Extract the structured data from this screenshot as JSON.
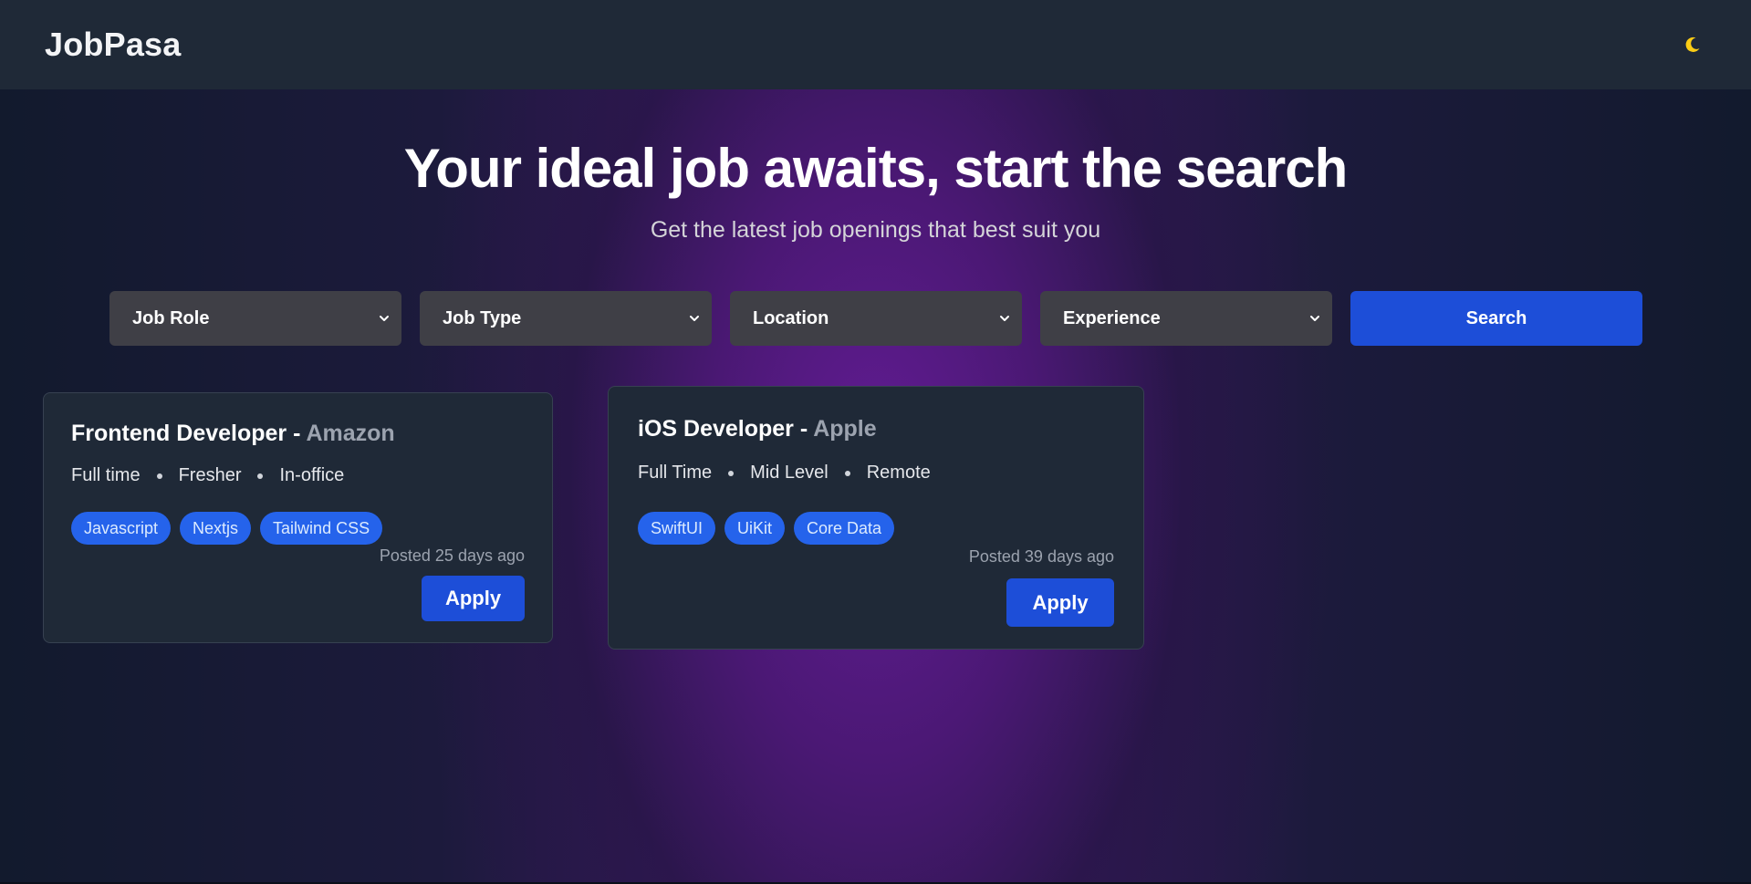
{
  "navbar": {
    "brand": "JobPasa",
    "theme_icon": "crescent-moon-icon"
  },
  "hero": {
    "title": "Your ideal job awaits, start the search",
    "subtitle": "Get the latest job openings that best suit you"
  },
  "filters": {
    "job_role": "Job Role",
    "job_type": "Job Type",
    "location": "Location",
    "experience": "Experience",
    "search_label": "Search"
  },
  "jobs": [
    {
      "title": "Frontend Developer",
      "separator": " - ",
      "company": "Amazon",
      "meta": [
        "Full time",
        "Fresher",
        "In-office"
      ],
      "tags": [
        "Javascript",
        "Nextjs",
        "Tailwind CSS"
      ],
      "posted": "Posted 25 days ago",
      "apply_label": "Apply"
    },
    {
      "title": "iOS Developer",
      "separator": " - ",
      "company": "Apple",
      "meta": [
        "Full Time",
        "Mid Level",
        "Remote"
      ],
      "tags": [
        "SwiftUI",
        "UiKit",
        "Core Data"
      ],
      "posted": "Posted 39 days ago",
      "apply_label": "Apply"
    }
  ],
  "colors": {
    "navbar_bg": "#1f2937",
    "accent_blue": "#1d4ed8",
    "tag_blue": "#2563eb",
    "select_bg": "#3f3f46",
    "card_bg": "#1f2937",
    "moon_yellow": "#facc15",
    "hero_purple": "#5b1a8c"
  }
}
